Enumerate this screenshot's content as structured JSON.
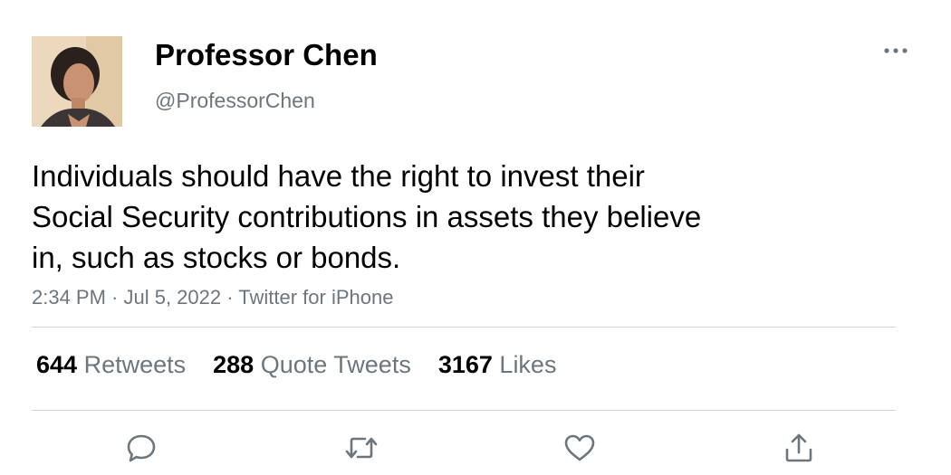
{
  "author": {
    "name": "Professor Chen",
    "handle": "@ProfessorChen"
  },
  "tweet": {
    "text_lines": [
      "Individuals should have the right to invest their",
      "Social Security contributions in assets they believe",
      "in, such as stocks or bonds."
    ],
    "meta": "2:34 PM · Jul 5, 2022 · Twitter for iPhone"
  },
  "stats": {
    "retweets_count": "644",
    "retweets_label": "Retweets",
    "quotes_count": "288",
    "quotes_label": "Quote Tweets",
    "likes_count": "3167",
    "likes_label": "Likes"
  },
  "actions": {
    "icons": [
      "reply-icon",
      "retweet-icon",
      "like-icon",
      "share-icon"
    ]
  },
  "colors": {
    "secondary_text": "#6e767d",
    "divider": "#cfd6db",
    "icon": "#6e767d"
  }
}
